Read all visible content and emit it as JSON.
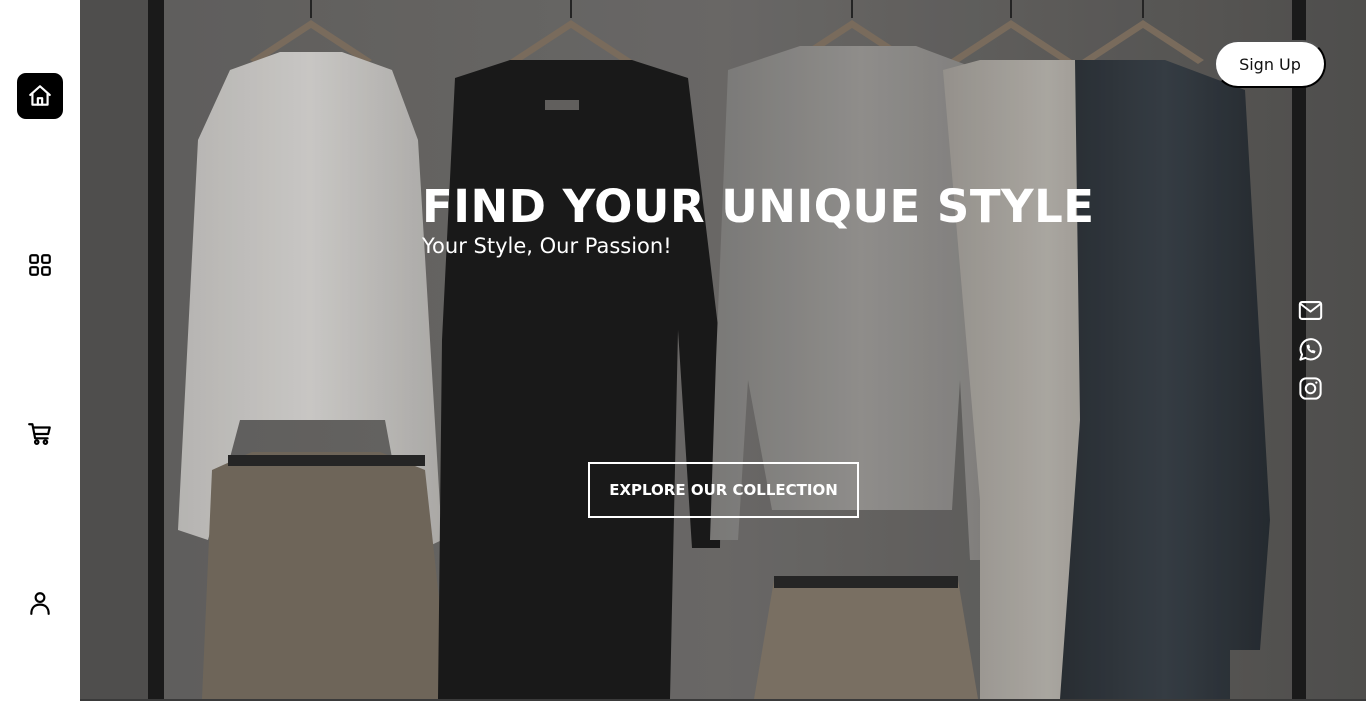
{
  "sidebar": {
    "items": [
      {
        "icon": "home-icon",
        "active": true
      },
      {
        "icon": "grid-icon",
        "active": false
      },
      {
        "icon": "cart-icon",
        "active": false
      },
      {
        "icon": "user-icon",
        "active": false
      }
    ]
  },
  "header": {
    "signup_label": "Sign Up"
  },
  "hero": {
    "title": "FIND YOUR UNIQUE STYLE",
    "subtitle": "Your Style, Our Passion!",
    "cta_label": "EXPLORE OUR COLLECTION",
    "background_image": "clothing-rack-photo"
  },
  "social": [
    {
      "icon": "mail-icon"
    },
    {
      "icon": "whatsapp-icon"
    },
    {
      "icon": "instagram-icon"
    }
  ],
  "colors": {
    "accent": "#000000",
    "text_on_hero": "#ffffff"
  }
}
